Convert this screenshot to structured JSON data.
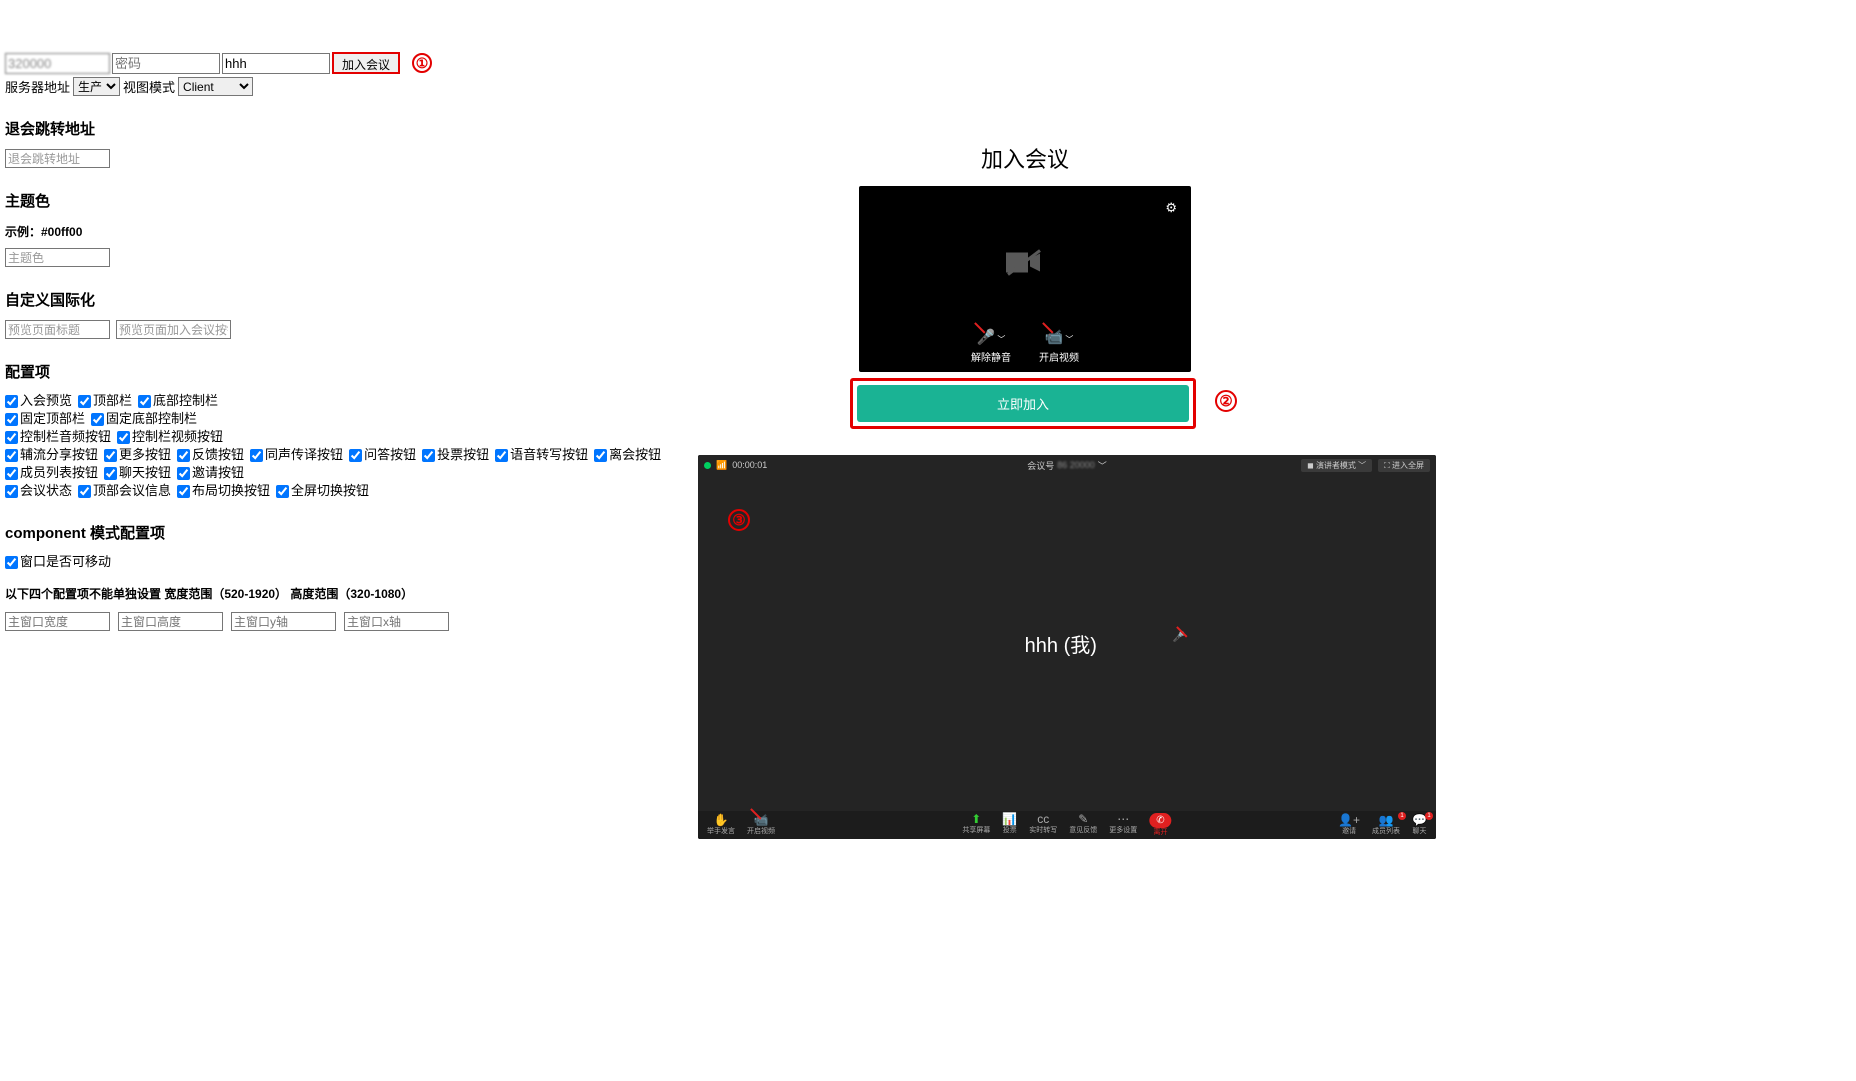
{
  "topForm": {
    "meetingId": "320000",
    "pwdPlaceholder": "密码",
    "name": "hhh",
    "joinBtn": "加入会议",
    "serverLabel": "服务器地址",
    "serverOpt": "生产",
    "viewLabel": "视图模式",
    "viewOpt": "Client"
  },
  "sections": {
    "leaveUrl": {
      "title": "退会跳转地址",
      "placeholder": "退会跳转地址"
    },
    "theme": {
      "title": "主题色",
      "example": "示例：#00ff00",
      "placeholder": "主题色"
    },
    "i18n": {
      "title": "自定义国际化",
      "ph1": "预览页面标题",
      "ph2": "预览页面加入会议按钮文本"
    },
    "config": {
      "title": "配置项"
    },
    "component": {
      "title": "component 模式配置项",
      "moveable": "窗口是否可移动",
      "note": "以下四个配置项不能单独设置 宽度范围（520-1920） 高度范围（320-1080）"
    }
  },
  "checkboxes": {
    "r1": [
      "入会预览",
      "顶部栏",
      "底部控制栏"
    ],
    "r2": [
      "固定顶部栏",
      "固定底部控制栏"
    ],
    "r3": [
      "控制栏音频按钮",
      "控制栏视频按钮"
    ],
    "r4": [
      "辅流分享按钮",
      "更多按钮",
      "反馈按钮",
      "同声传译按钮",
      "问答按钮",
      "投票按钮",
      "语音转写按钮",
      "离会按钮"
    ],
    "r5": [
      "成员列表按钮",
      "聊天按钮",
      "邀请按钮"
    ],
    "r6": [
      "会议状态",
      "顶部会议信息",
      "布局切换按钮",
      "全屏切换按钮"
    ]
  },
  "dims": {
    "w": "主窗口宽度",
    "h": "主窗口高度",
    "y": "主窗口y轴",
    "x": "主窗口x轴"
  },
  "joinPanel": {
    "title": "加入会议",
    "unmute": "解除静音",
    "openVideo": "开启视频",
    "joinNow": "立即加入"
  },
  "meeting": {
    "time": "00:00:01",
    "idLabel": "会议号",
    "idVal": "86 20000",
    "speakerMode": "演讲者模式",
    "fullscreen": "进入全屏",
    "participant": "hhh (我)",
    "toolbar": {
      "raise": "举手发言",
      "video": "开启视频",
      "share": "共享屏幕",
      "vote": "投票",
      "transcribe": "实时转写",
      "feedback": "意见反馈",
      "more": "更多设置",
      "leave": "离开",
      "invite": "邀请",
      "members": "成员列表",
      "chat": "聊天"
    },
    "badge": "1"
  },
  "markers": {
    "one": "①",
    "two": "②",
    "three": "③"
  }
}
